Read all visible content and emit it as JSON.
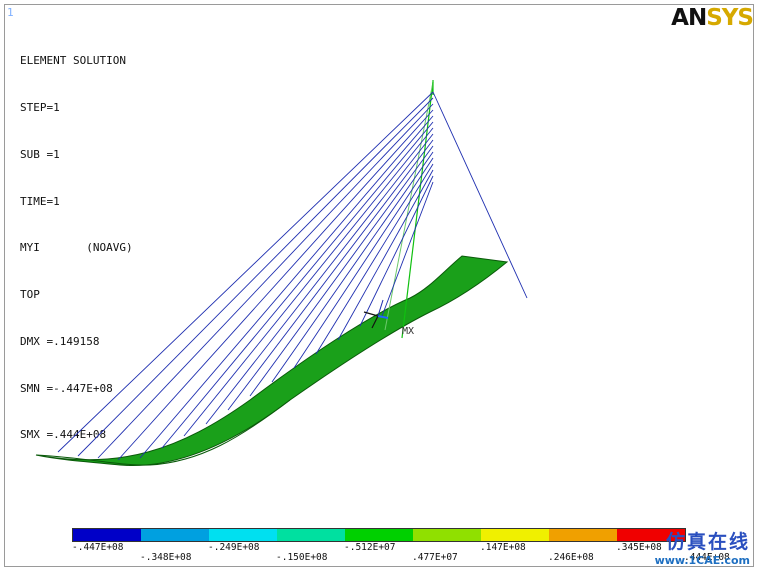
{
  "header": {
    "window_number": "1",
    "logo_part1": "AN",
    "logo_part2": "SYS"
  },
  "solution_info": {
    "title": "ELEMENT SOLUTION",
    "lines": [
      "STEP=1",
      "SUB =1",
      "TIME=1",
      "MYI       (NOAVG)",
      "TOP",
      "DMX =.149158",
      "SMN =-.447E+08",
      "SMX =.444E+08"
    ]
  },
  "model": {
    "marker_label": "MX",
    "colors": {
      "cable": "#1f2fb0",
      "deck": "#1aa01a",
      "deck_edge": "#0a5a0a",
      "pylon": "#10c010"
    }
  },
  "legend": {
    "colors": [
      "#0000c8",
      "#00a0e0",
      "#00e0f0",
      "#00e0a0",
      "#00d000",
      "#90e000",
      "#f0f000",
      "#f0a000",
      "#f00000"
    ],
    "labels": [
      "-.447E+08",
      "-.348E+08",
      "-.249E+08",
      "-.150E+08",
      "-.512E+07",
      ".477E+07",
      ".147E+08",
      ".246E+08",
      ".345E+08",
      ".444E+08"
    ]
  },
  "watermark": {
    "cn_text": "仿真在线",
    "url": "www.1CAE.com"
  }
}
